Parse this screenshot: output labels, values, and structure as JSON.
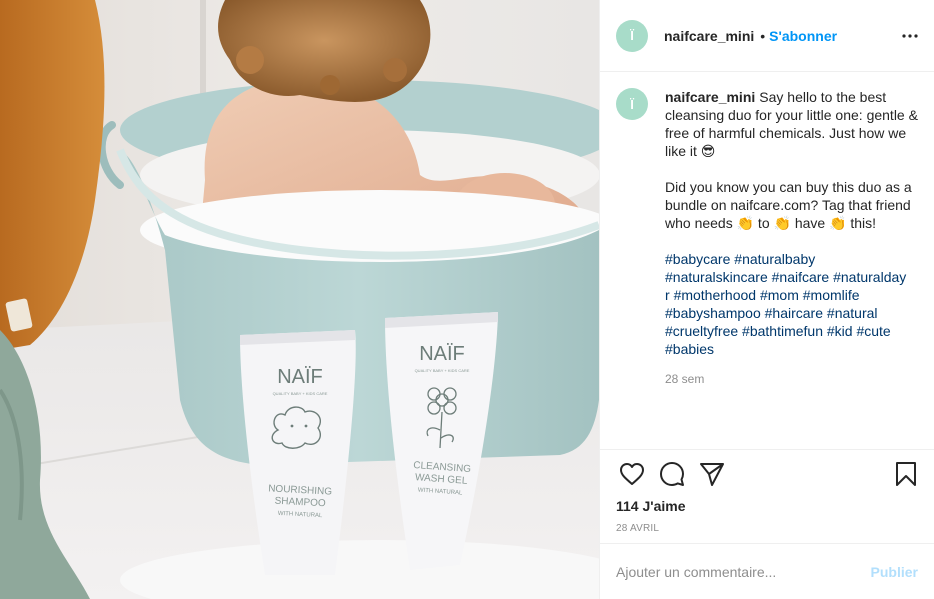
{
  "post": {
    "photo": {
      "bottle_left": {
        "brand": "NAÏF",
        "small_text": "QUALITY BABY + KIDS CARE",
        "product_line1": "NOURISHING",
        "product_line2": "SHAMPOO",
        "product_line3": "WITH NATURAL"
      },
      "bottle_right": {
        "brand": "NAÏF",
        "small_text": "QUALITY BABY + KIDS CARE",
        "product_line1": "CLEANSING",
        "product_line2": "WASH GEL",
        "product_line3": "WITH NATURAL"
      }
    },
    "header": {
      "avatar_glyph": "Ï",
      "username": "naifcare_mini",
      "separator": "•",
      "follow_label": "S'abonner",
      "more_icon": "more-horizontal-icon"
    },
    "caption": {
      "username": "naifcare_mini",
      "paragraph1": "Say hello to the best cleansing duo for your little one: gentle & free of harmful chemicals. Just how we like it 😎",
      "paragraph2": "Did you know you can buy this duo as a bundle on naifcare.com? Tag that friend who needs 👏 to 👏 have 👏 this!",
      "hashtags": [
        "#babycare",
        "#naturalbaby",
        "#naturalskincare",
        "#naifcare",
        "#naturalday",
        "r",
        "#motherhood",
        "#mom",
        "#momlife",
        "#babyshampoo",
        "#haircare",
        "#natural",
        "#crueltyfree",
        "#bathtimefun",
        "#kid",
        "#cute",
        "#babies"
      ],
      "time_ago": "28 sem"
    },
    "actions": {
      "like_icon": "heart-icon",
      "comment_icon": "comment-icon",
      "share_icon": "paper-plane-icon",
      "save_icon": "bookmark-icon",
      "likes_text": "114 J'aime",
      "date_text": "28 AVRIL"
    },
    "add_comment": {
      "placeholder": "Ajouter un commentaire...",
      "publish_label": "Publier"
    },
    "colors": {
      "accent": "#0095f6",
      "publish_disabled": "#b2dffc",
      "hashtag": "#00376b",
      "avatar": "#a8dcc9",
      "text": "#262626",
      "muted": "#8e8e8e",
      "tub": "#b7d4d3"
    }
  }
}
